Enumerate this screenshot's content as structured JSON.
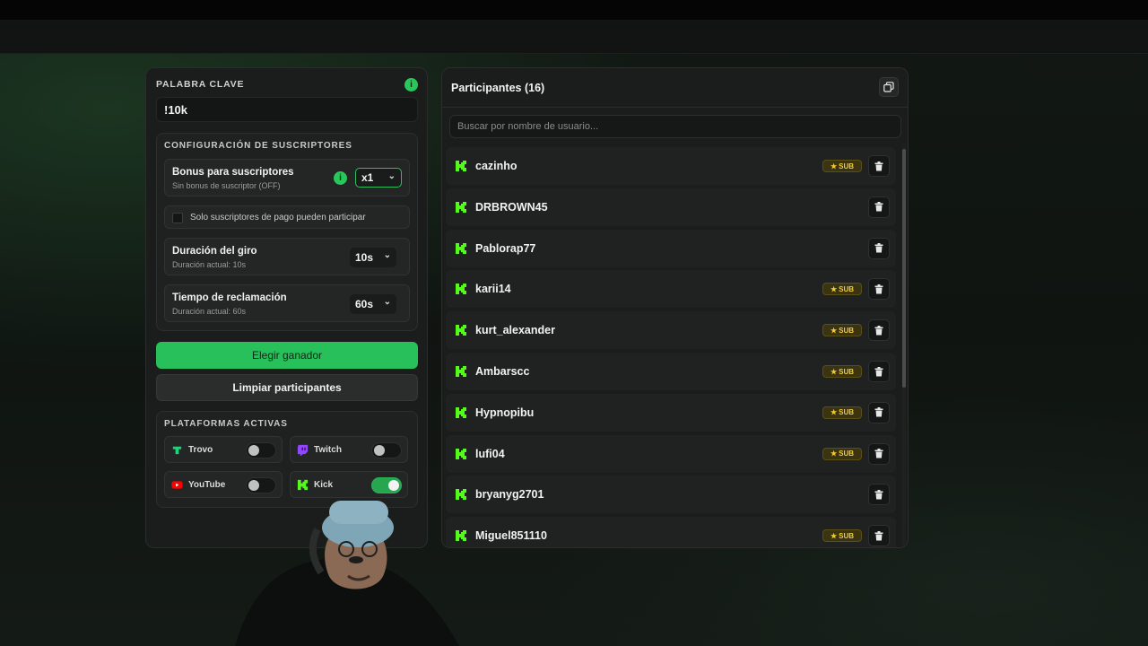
{
  "keyword": {
    "label": "PALABRA CLAVE",
    "value": "!10k",
    "info": "i"
  },
  "subscriber_config": {
    "title": "CONFIGURACIÓN DE SUSCRIPTORES",
    "bonus": {
      "title": "Bonus para suscriptores",
      "subtitle": "Sin bonus de suscriptor (OFF)",
      "info": "i",
      "selected": "x1"
    },
    "paid_only": {
      "label": "Solo suscriptores de pago pueden participar",
      "checked": false
    },
    "spin_duration": {
      "title": "Duración del giro",
      "subtitle": "Duración actual: 10s",
      "selected": "10s"
    },
    "claim_time": {
      "title": "Tiempo de reclamación",
      "subtitle": "Duración actual: 60s",
      "selected": "60s"
    }
  },
  "actions": {
    "pick_winner": "Elegir ganador",
    "clear_participants": "Limpiar participantes"
  },
  "platforms": {
    "title": "PLATAFORMAS ACTIVAS",
    "items": [
      {
        "name": "Trovo",
        "enabled": false,
        "icon": "trovo-icon",
        "color": "#1fd17a"
      },
      {
        "name": "Twitch",
        "enabled": false,
        "icon": "twitch-icon",
        "color": "#9146ff"
      },
      {
        "name": "YouTube",
        "enabled": false,
        "icon": "youtube-icon",
        "color": "#ff0000"
      },
      {
        "name": "Kick",
        "enabled": true,
        "icon": "kick-icon",
        "color": "#53fc18"
      }
    ]
  },
  "participants": {
    "title": "Participantes (16)",
    "search_placeholder": "Buscar por nombre de usuario...",
    "badge_label": "SUB",
    "items": [
      {
        "name": "cazinho",
        "sub": true
      },
      {
        "name": "DRBROWN45",
        "sub": false
      },
      {
        "name": "Pablorap77",
        "sub": false
      },
      {
        "name": "karii14",
        "sub": true
      },
      {
        "name": "kurt_alexander",
        "sub": true
      },
      {
        "name": "Ambarscc",
        "sub": true
      },
      {
        "name": "Hypnopibu",
        "sub": true
      },
      {
        "name": "lufi04",
        "sub": true
      },
      {
        "name": "bryanyg2701",
        "sub": false
      },
      {
        "name": "Miguel851110",
        "sub": true
      }
    ]
  },
  "colors": {
    "accent": "#27c05a",
    "kick": "#53fc18",
    "sub_badge": "#f0c93a"
  }
}
